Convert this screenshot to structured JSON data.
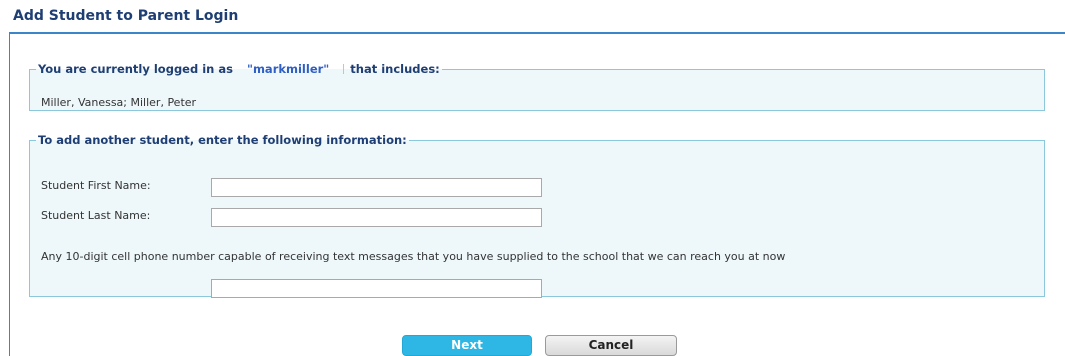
{
  "page": {
    "title": "Add Student to Parent Login"
  },
  "login_section": {
    "legend_prefix": "You are currently logged in as",
    "username": "\"markmiller\"",
    "legend_suffix": "that includes:",
    "students": "Miller, Vanessa; Miller, Peter"
  },
  "add_section": {
    "legend": "To add another student, enter the following information:",
    "first_name_label": "Student First Name:",
    "first_name_value": "",
    "last_name_label": "Student Last Name:",
    "last_name_value": "",
    "phone_instructions": "Any 10-digit cell phone number capable of receiving text messages that you have supplied to the school that we can reach you at now",
    "phone_value": ""
  },
  "actions": {
    "next_label": "Next",
    "cancel_label": "Cancel"
  },
  "colors": {
    "title": "#1f3f74",
    "frame_border": "#3a86c8",
    "fieldset_border": "#8cc8dc",
    "fieldset_bg": "#eef8fb",
    "username": "#2f5fc4",
    "next_button": "#2eb7e5"
  }
}
